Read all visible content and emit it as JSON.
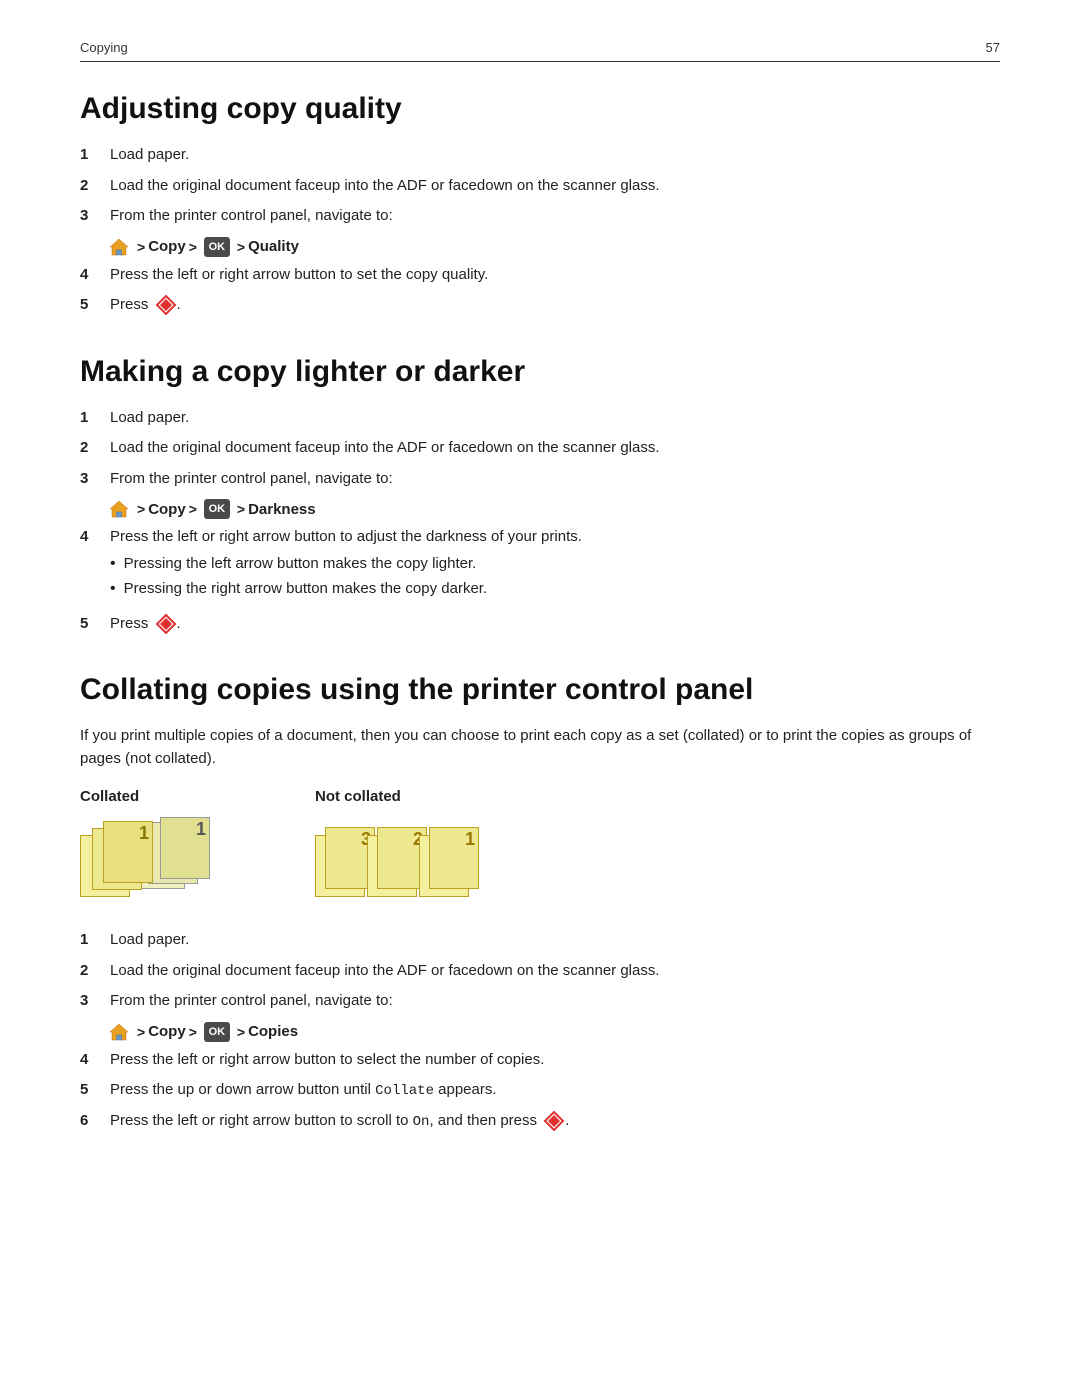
{
  "header": {
    "section": "Copying",
    "page_number": "57"
  },
  "section1": {
    "title": "Adjusting copy quality",
    "steps": [
      {
        "num": "1",
        "text": "Load paper."
      },
      {
        "num": "2",
        "text": "Load the original document faceup into the ADF or facedown on the scanner glass."
      },
      {
        "num": "3",
        "text": "From the printer control panel, navigate to:"
      },
      {
        "num": "4",
        "text": "Press the left or right arrow button to set the copy quality."
      },
      {
        "num": "5",
        "text": "Press"
      }
    ],
    "nav": {
      "copy_label": "Copy",
      "quality_label": "Quality"
    }
  },
  "section2": {
    "title": "Making a copy lighter or darker",
    "steps": [
      {
        "num": "1",
        "text": "Load paper."
      },
      {
        "num": "2",
        "text": "Load the original document faceup into the ADF or facedown on the scanner glass."
      },
      {
        "num": "3",
        "text": "From the printer control panel, navigate to:"
      },
      {
        "num": "4",
        "text": "Press the left or right arrow button to adjust the darkness of your prints."
      },
      {
        "num": "5",
        "text": "Press"
      }
    ],
    "nav": {
      "copy_label": "Copy",
      "darkness_label": "Darkness"
    },
    "bullets": [
      "Pressing the left arrow button makes the copy lighter.",
      "Pressing the right arrow button makes the copy darker."
    ]
  },
  "section3": {
    "title": "Collating copies using the printer control panel",
    "intro": "If you print multiple copies of a document, then you can choose to print each copy as a set (collated) or to print the copies as groups of pages (not collated).",
    "collated_label": "Collated",
    "not_collated_label": "Not collated",
    "steps": [
      {
        "num": "1",
        "text": "Load paper."
      },
      {
        "num": "2",
        "text": "Load the original document faceup into the ADF or facedown on the scanner glass."
      },
      {
        "num": "3",
        "text": "From the printer control panel, navigate to:"
      },
      {
        "num": "4",
        "text": "Press the left or right arrow button to select the number of copies."
      },
      {
        "num": "5",
        "text": "Press the up or down arrow button until "
      },
      {
        "num": "6",
        "text": "Press the left or right arrow button to scroll to On, and then press"
      }
    ],
    "nav": {
      "copy_label": "Copy",
      "copies_label": "Copies"
    },
    "step5_code": "Collate",
    "step5_suffix": " appears.",
    "step6_on": "On",
    "step6_suffix": ", and then press"
  }
}
